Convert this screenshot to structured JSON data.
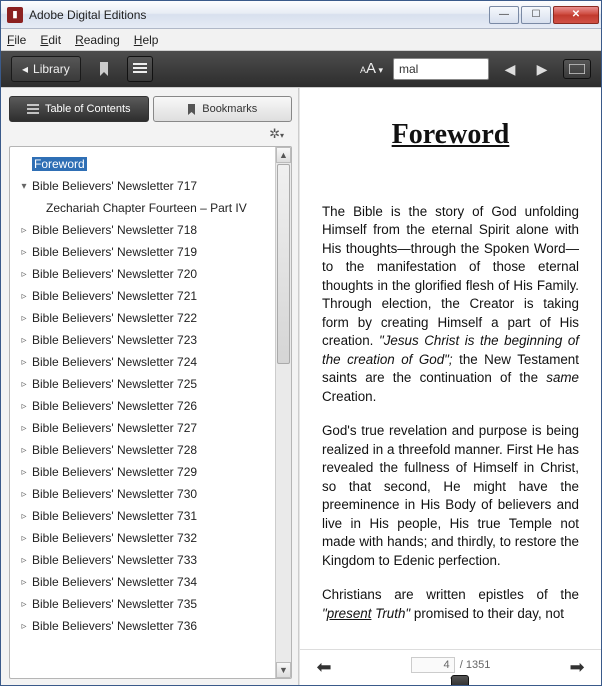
{
  "window": {
    "title": "Adobe Digital Editions"
  },
  "menu": {
    "file": "File",
    "edit": "Edit",
    "reading": "Reading",
    "help": "Help"
  },
  "toolbar": {
    "library_label": "Library",
    "font_label": "A",
    "font_small": "A",
    "search_value": "mal"
  },
  "sidebar": {
    "tabs": {
      "toc": "Table of Contents",
      "bookmarks": "Bookmarks"
    },
    "items": [
      {
        "label": "Foreword",
        "type": "sel"
      },
      {
        "label": "Bible Believers' Newsletter 717",
        "type": "expanded"
      },
      {
        "label": "Zechariah Chapter Fourteen – Part IV",
        "type": "child"
      },
      {
        "label": "Bible Believers' Newsletter 718",
        "type": "collapsed"
      },
      {
        "label": "Bible Believers' Newsletter 719",
        "type": "collapsed"
      },
      {
        "label": "Bible Believers' Newsletter 720",
        "type": "collapsed"
      },
      {
        "label": "Bible Believers' Newsletter 721",
        "type": "collapsed"
      },
      {
        "label": "Bible Believers' Newsletter 722",
        "type": "collapsed"
      },
      {
        "label": "Bible Believers' Newsletter 723",
        "type": "collapsed"
      },
      {
        "label": "Bible Believers' Newsletter 724",
        "type": "collapsed"
      },
      {
        "label": "Bible Believers' Newsletter 725",
        "type": "collapsed"
      },
      {
        "label": "Bible Believers' Newsletter 726",
        "type": "collapsed"
      },
      {
        "label": "Bible Believers' Newsletter 727",
        "type": "collapsed"
      },
      {
        "label": "Bible Believers' Newsletter 728",
        "type": "collapsed"
      },
      {
        "label": "Bible Believers' Newsletter 729",
        "type": "collapsed"
      },
      {
        "label": "Bible Believers' Newsletter 730",
        "type": "collapsed"
      },
      {
        "label": "Bible Believers' Newsletter 731",
        "type": "collapsed"
      },
      {
        "label": "Bible Believers' Newsletter 732",
        "type": "collapsed"
      },
      {
        "label": "Bible Believers' Newsletter 733",
        "type": "collapsed"
      },
      {
        "label": "Bible Believers' Newsletter 734",
        "type": "collapsed"
      },
      {
        "label": "Bible Believers' Newsletter 735",
        "type": "collapsed"
      },
      {
        "label": "Bible Believers' Newsletter 736",
        "type": "collapsed"
      }
    ]
  },
  "doc": {
    "title": "Foreword",
    "p1a": "The Bible is the story of God unfolding Himself from the eternal Spirit alone with His thoughts—through the Spoken Word—to the manifestation of those eternal thoughts in the glorified flesh of His Family. Through election, the Creator is taking form by creating Himself a part of His creation. ",
    "p1b": "\"Jesus Christ is the beginning of the creation of God\";",
    "p1c": " the New Testament saints are the continuation of the ",
    "p1d": "same",
    "p1e": " Creation.",
    "p2": "God's true revelation and purpose is being realized in a threefold manner. First He has revealed the fullness of Himself in Christ, so that second, He might have the preeminence in His Body of believers and live in His people, His true Temple not made with hands; and thirdly, to restore the Kingdom to Edenic perfection.",
    "p3a": "Christians are written epistles of the ",
    "p3b": "\"",
    "p3c": "present",
    "p3d": " Truth\"",
    "p3e": " promised to their day, not"
  },
  "pager": {
    "current": "4",
    "sep": " / ",
    "total": "1351"
  }
}
